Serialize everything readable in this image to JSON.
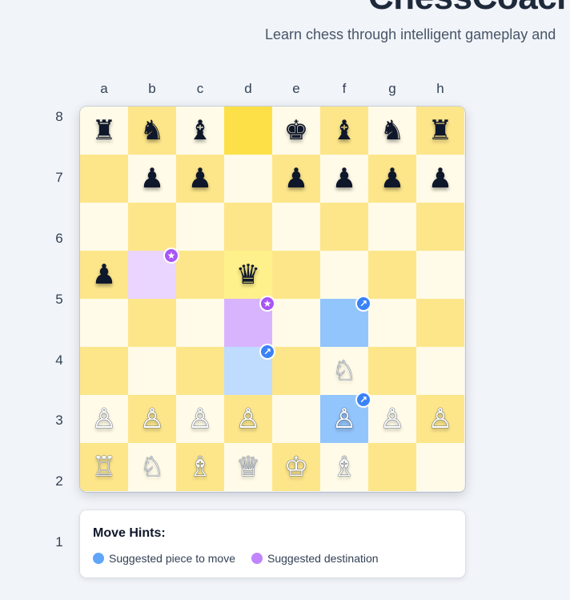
{
  "header": {
    "title": "ChessCoach",
    "subtitle": "Learn chess through intelligent gameplay and"
  },
  "board": {
    "files": [
      "a",
      "b",
      "c",
      "d",
      "e",
      "f",
      "g",
      "h"
    ],
    "ranks": [
      "8",
      "7",
      "6",
      "5",
      "4",
      "3",
      "2",
      "1"
    ],
    "rows": [
      [
        "r",
        "n",
        "b",
        "",
        "k",
        "b",
        "n",
        "r"
      ],
      [
        "",
        "p",
        "p",
        "",
        "p",
        "p",
        "p",
        "p"
      ],
      [
        "",
        "",
        "",
        "",
        "",
        "",
        "",
        ""
      ],
      [
        "p",
        "",
        "",
        "q",
        "",
        "",
        "",
        ""
      ],
      [
        "",
        "",
        "",
        "",
        "",
        "",
        "",
        ""
      ],
      [
        "",
        "",
        "",
        "",
        "",
        "N",
        "",
        ""
      ],
      [
        "P",
        "P",
        "P",
        "P",
        "",
        "P",
        "P",
        "P"
      ],
      [
        "R",
        "N",
        "B",
        "Q",
        "K",
        "B",
        "",
        ""
      ]
    ],
    "rows_note_visible": "pieces as displayed",
    "selected_square": "d8",
    "highlighted_square": "d5",
    "hint_source_squares": [
      "f4",
      "d3",
      "f2"
    ],
    "hint_destination_squares": [
      "b5",
      "d4"
    ]
  },
  "legend": {
    "title": "Move Hints:",
    "items": [
      {
        "label": "Suggested piece to move",
        "color": "#60a5fa"
      },
      {
        "label": "Suggested destination",
        "color": "#c084fc"
      }
    ]
  },
  "colors": {
    "light_square": "#fffbe8",
    "dark_square": "#fde68a",
    "hint_blue": "#3b82f6",
    "hint_purple": "#a855f7"
  }
}
